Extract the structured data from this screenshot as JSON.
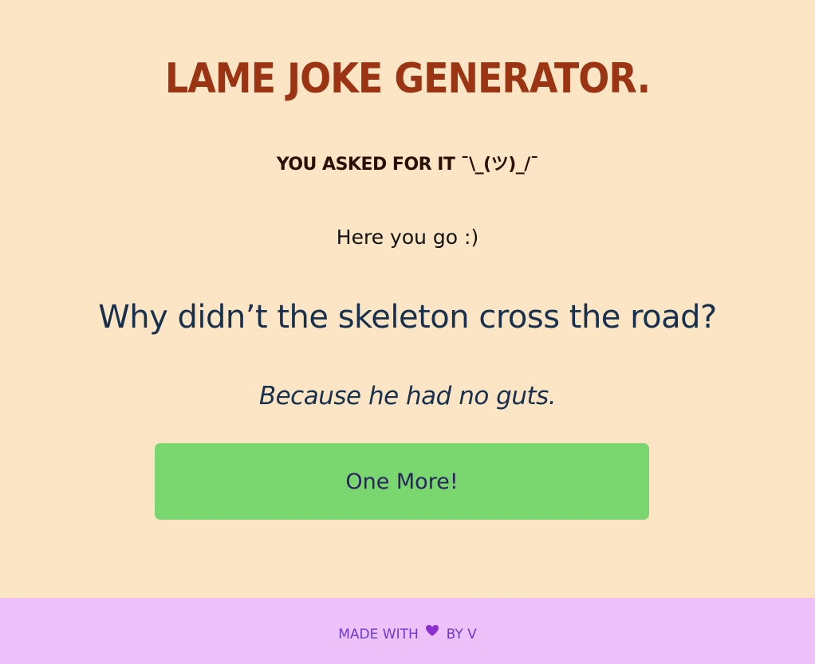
{
  "header": {
    "title": "LAME JOKE GENERATOR.",
    "subtitle": "YOU ASKED FOR IT ¯\\_(ツ)_/¯"
  },
  "joke": {
    "intro": "Here you go :)",
    "setup": "Why didn’t the skeleton cross the road?",
    "punchline": "Because he had no guts."
  },
  "actions": {
    "one_more_label": "One More!"
  },
  "footer": {
    "made_with": "MADE WITH",
    "by": "BY V",
    "heart_icon": "heart-icon",
    "heart_color": "#8b2fd0"
  },
  "colors": {
    "background": "#fbe5c4",
    "title": "#9b3412",
    "button": "#7ad66f",
    "footer_bg": "#efc1fb",
    "footer_text": "#6b3bd2"
  }
}
